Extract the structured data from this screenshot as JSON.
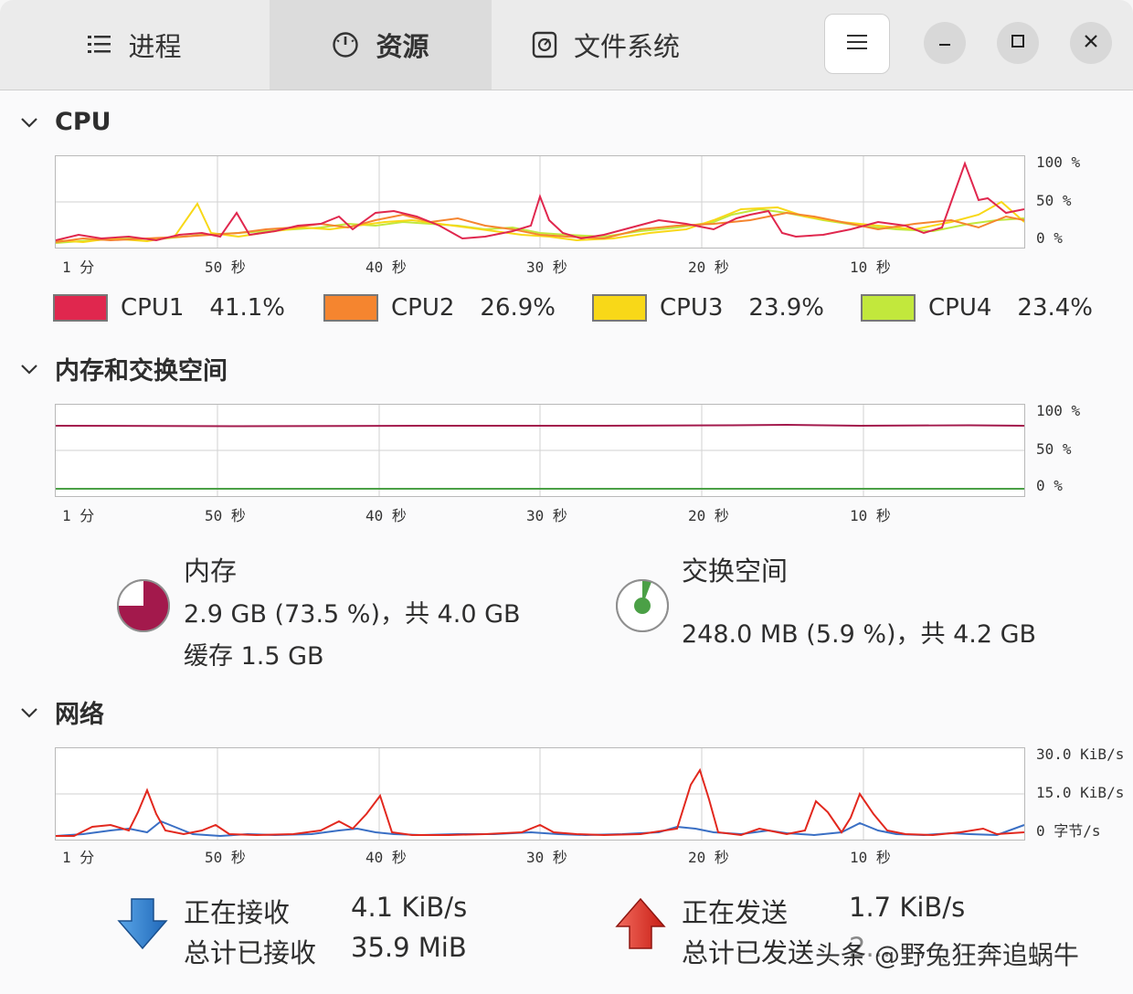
{
  "tabs": [
    {
      "label": "进程",
      "icon": "list-icon"
    },
    {
      "label": "资源",
      "icon": "gauge-icon"
    },
    {
      "label": "文件系统",
      "icon": "disk-icon"
    }
  ],
  "window_controls": [
    "menu-icon",
    "minimize-icon",
    "maximize-icon",
    "close-icon"
  ],
  "cpu": {
    "title": "CPU",
    "y_labels": [
      "100 %",
      "50 %",
      "0 %"
    ],
    "x_labels": [
      "1 分",
      "50 秒",
      "40 秒",
      "30 秒",
      "20 秒",
      "10 秒"
    ],
    "legend": [
      {
        "name": "CPU1",
        "value": "41.1%",
        "color": "#e0274e"
      },
      {
        "name": "CPU2",
        "value": "26.9%",
        "color": "#f5852f"
      },
      {
        "name": "CPU3",
        "value": "23.9%",
        "color": "#f8d818"
      },
      {
        "name": "CPU4",
        "value": "23.4%",
        "color": "#c2e83c"
      }
    ]
  },
  "memory": {
    "title": "内存和交换空间",
    "y_labels": [
      "100 %",
      "50 %",
      "0 %"
    ],
    "x_labels": [
      "1 分",
      "50 秒",
      "40 秒",
      "30 秒",
      "20 秒",
      "10 秒"
    ],
    "mem_label": "内存",
    "mem_usage": "2.9 GB (73.5 %)，共 4.0 GB",
    "mem_cache": "缓存 1.5 GB",
    "mem_fraction": 0.735,
    "mem_color": "#a3194c",
    "swap_label": "交换空间",
    "swap_usage": "248.0 MB (5.9 %)，共 4.2 GB",
    "swap_fraction": 0.059,
    "swap_color": "#4ba046"
  },
  "network": {
    "title": "网络",
    "y_labels": [
      "30.0 KiB/s",
      "15.0 KiB/s",
      "0 字节/s"
    ],
    "x_labels": [
      "1 分",
      "50 秒",
      "40 秒",
      "30 秒",
      "20 秒",
      "10 秒"
    ],
    "recv_label": "正在接收",
    "recv_value": "4.1 KiB/s",
    "total_recv_label": "总计已接收",
    "total_recv_value": "35.9 MiB",
    "send_label": "正在发送",
    "send_value": "1.7 KiB/s",
    "total_send_label": "总计已发送",
    "total_send_value": "2..."
  },
  "watermark": "头条 @野兔狂奔追蜗牛"
}
